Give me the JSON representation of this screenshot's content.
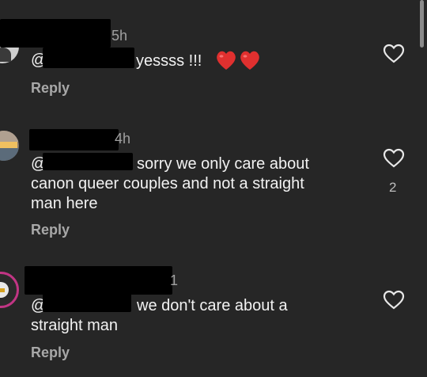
{
  "comments": [
    {
      "time": "5h",
      "mention": "@:",
      "text": "yessss !!!",
      "emoji": "❤️❤️",
      "reply": "Reply",
      "likes": ""
    },
    {
      "time": "4h",
      "mention": "@",
      "text": "sorry we only care about\ncanon queer couples and not a straight\nman here",
      "reply": "Reply",
      "likes": "2"
    },
    {
      "time": "1",
      "mention": "@:",
      "text": "we don't care about a\nstraight man",
      "reply": "Reply",
      "likes": ""
    }
  ],
  "icons": {
    "like": "heart-outline-icon",
    "emoji": "red-heart-emoji"
  },
  "colors": {
    "background": "#262626",
    "text": "#f2f2f2",
    "muted": "#a8a8a8",
    "emoji_red": "#e0302f"
  }
}
